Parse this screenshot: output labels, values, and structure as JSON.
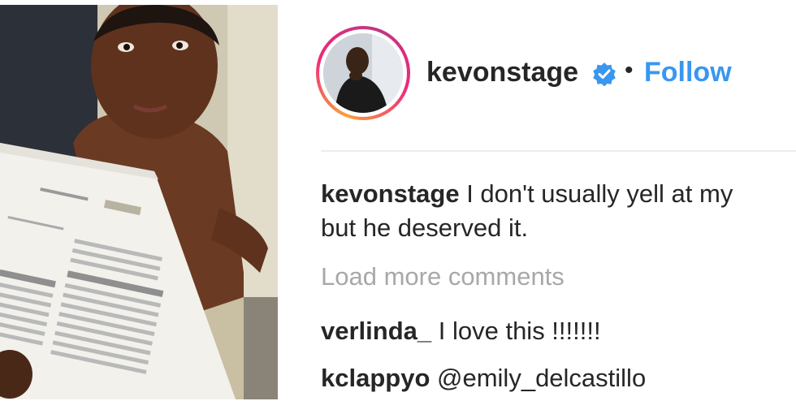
{
  "post": {
    "author": "kevonstage",
    "follow_label": "Follow",
    "separator": "•",
    "caption": {
      "username": "kevonstage",
      "line1": "I don't usually yell at my",
      "line2": "but he deserved it."
    },
    "load_more_label": "Load more comments",
    "comments": [
      {
        "username": "verlinda_",
        "text": "I love this !!!!!!!"
      },
      {
        "username": "kclappyo",
        "text": "@emily_delcastillo"
      }
    ]
  },
  "icons": {
    "verified": "verified-badge-icon"
  },
  "colors": {
    "link": "#3897f0",
    "text": "#262626",
    "muted": "#a8a8a8",
    "verified": "#3897f0"
  }
}
